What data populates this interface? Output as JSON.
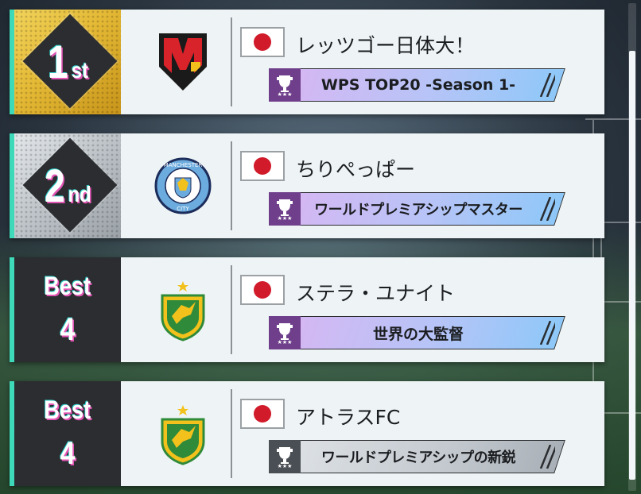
{
  "theme": {
    "accent": "#3dd9b8",
    "gold": "#e4b935",
    "silver": "#b9bfc4",
    "dark_panel": "#2b2d30",
    "flag_red": "#d11a2a"
  },
  "entries": [
    {
      "rank_number": "1",
      "rank_suffix": "st",
      "rank_style": "gold",
      "crest": "red-black-m-shield-icon",
      "flag": "japan-flag-icon",
      "team_name": "レッツゴー日体大！",
      "award_label": "WPS TOP20 -Season 1-",
      "award_style": "pink"
    },
    {
      "rank_number": "2",
      "rank_suffix": "nd",
      "rank_style": "silver",
      "crest": "manchester-city-crest-icon",
      "crest_text_top": "MANCHESTER",
      "crest_text_bottom": "CITY",
      "flag": "japan-flag-icon",
      "team_name": "ちりぺっぱー",
      "award_label": "ワールドプレミアシップマスター",
      "award_style": "pink"
    },
    {
      "rank_word": "Best",
      "rank_value": "4",
      "rank_style": "dark",
      "crest": "green-yellow-bird-crest-icon",
      "flag": "japan-flag-icon",
      "team_name": "ステラ・ユナイト",
      "award_label": "世界の大監督",
      "award_style": "pink"
    },
    {
      "rank_word": "Best",
      "rank_value": "4",
      "rank_style": "dark",
      "crest": "green-yellow-bird-crest-icon",
      "flag": "japan-flag-icon",
      "team_name": "アトラスFC",
      "award_label": "ワールドプレミアシップの新鋭",
      "award_style": "grey"
    }
  ]
}
